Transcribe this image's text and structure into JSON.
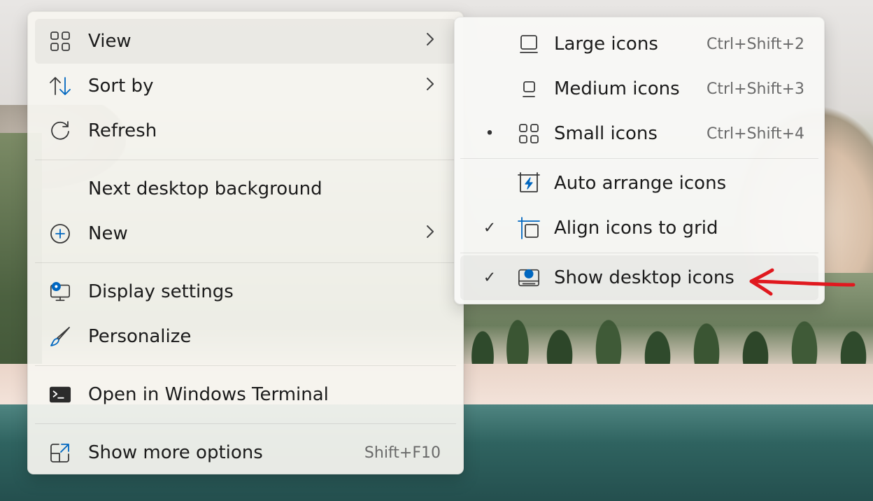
{
  "main_menu": {
    "items": [
      {
        "label": "View",
        "icon": "grid-icon"
      },
      {
        "label": "Sort by",
        "icon": "sort-icon"
      },
      {
        "label": "Refresh",
        "icon": "refresh-icon"
      },
      {
        "label": "Next desktop background"
      },
      {
        "label": "New",
        "icon": "plus-circle-icon"
      },
      {
        "label": "Display settings",
        "icon": "display-settings-icon"
      },
      {
        "label": "Personalize",
        "icon": "brush-icon"
      },
      {
        "label": "Open in Windows Terminal",
        "icon": "terminal-icon"
      },
      {
        "label": "Show more options",
        "icon": "share-icon",
        "shortcut": "Shift+F10"
      }
    ]
  },
  "view_submenu": {
    "items": [
      {
        "label": "Large icons",
        "shortcut": "Ctrl+Shift+2",
        "icon": "large-icons-icon"
      },
      {
        "label": "Medium icons",
        "shortcut": "Ctrl+Shift+3",
        "icon": "medium-icons-icon"
      },
      {
        "label": "Small icons",
        "shortcut": "Ctrl+Shift+4",
        "icon": "small-icons-icon",
        "selected": true
      },
      {
        "label": "Auto arrange icons",
        "icon": "auto-arrange-icon"
      },
      {
        "label": "Align icons to grid",
        "icon": "align-grid-icon",
        "checked": true
      },
      {
        "label": "Show desktop icons",
        "icon": "show-desktop-icon",
        "checked": true
      }
    ]
  },
  "marks": {
    "bullet": "•",
    "check": "✓"
  },
  "colors": {
    "accent": "#0067c0",
    "annotation": "#e0191f"
  }
}
